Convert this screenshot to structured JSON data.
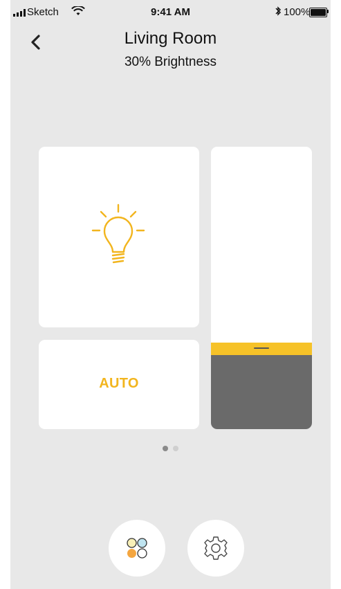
{
  "status_bar": {
    "carrier": "Sketch",
    "time": "9:41 AM",
    "bluetooth_icon": "bluetooth-icon",
    "battery_percent": "100%"
  },
  "header": {
    "title": "Living Room",
    "subtitle": "30% Brightness"
  },
  "controls": {
    "auto_label": "AUTO",
    "brightness_level": 0.3
  },
  "pager": {
    "pages": 2,
    "current": 1
  },
  "colors": {
    "accent": "#f2b51e",
    "background": "#e8e8e8",
    "tile": "#ffffff",
    "slider_fill": "#6a6a6a",
    "slider_handle": "#f6c228"
  },
  "icons": {
    "back": "chevron-left-icon",
    "bulb": "lightbulb-icon",
    "scenes": "color-circles-icon",
    "settings": "gear-icon"
  }
}
